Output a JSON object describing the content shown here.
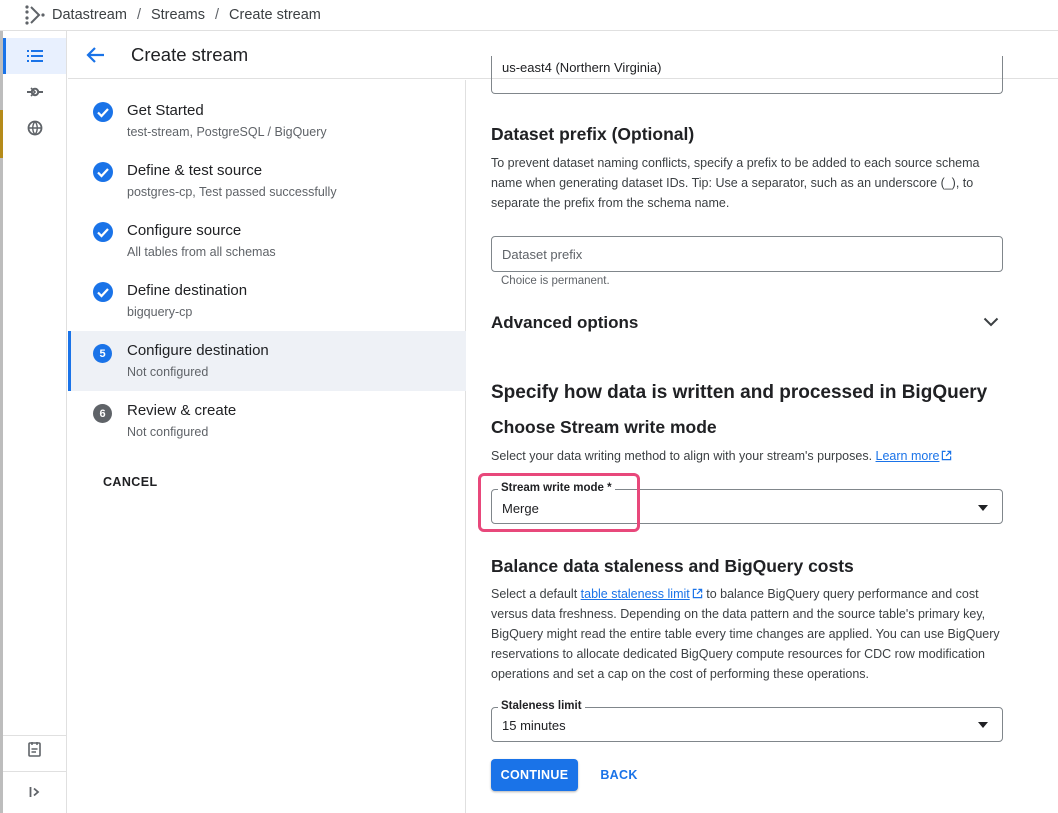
{
  "breadcrumb": {
    "items": [
      "Datastream",
      "Streams",
      "Create stream"
    ],
    "separator": "/"
  },
  "header": {
    "title": "Create stream"
  },
  "steps": [
    {
      "title": "Get Started",
      "subtitle": "test-stream, PostgreSQL / BigQuery",
      "status": "done"
    },
    {
      "title": "Define & test source",
      "subtitle": "postgres-cp, Test passed successfully",
      "status": "done"
    },
    {
      "title": "Configure source",
      "subtitle": "All tables from all schemas",
      "status": "done"
    },
    {
      "title": "Define destination",
      "subtitle": "bigquery-cp",
      "status": "done"
    },
    {
      "title": "Configure destination",
      "subtitle": "Not configured",
      "status": "current",
      "number": "5"
    },
    {
      "title": "Review & create",
      "subtitle": "Not configured",
      "status": "pending",
      "number": "6"
    }
  ],
  "cancel_label": "CANCEL",
  "region_field": {
    "value": "us-east4 (Northern Virginia)"
  },
  "dataset_prefix": {
    "heading": "Dataset prefix (Optional)",
    "description": "To prevent dataset naming conflicts, specify a prefix to be added to each source schema name when generating dataset IDs. Tip: Use a separator, such as an underscore (_), to separate the prefix from the schema name.",
    "placeholder": "Dataset prefix",
    "helper": "Choice is permanent."
  },
  "advanced_options": {
    "label": "Advanced options"
  },
  "write_section": {
    "heading": "Specify how data is written and processed in BigQuery",
    "subheading": "Choose Stream write mode",
    "description": "Select your data writing method to align with your stream's purposes.",
    "learn_more": "Learn more",
    "field_label": "Stream write mode *",
    "field_value": "Merge"
  },
  "staleness_section": {
    "heading": "Balance data staleness and BigQuery costs",
    "text_before_link": "Select a default",
    "link": "table staleness limit",
    "text_after_link": "to balance BigQuery query performance and cost versus data freshness. Depending on the data pattern and the source table's primary key, BigQuery might read the entire table every time changes are applied. You can use BigQuery reservations to allocate dedicated BigQuery compute resources for CDC row modification operations and set a cap on the cost of performing these operations.",
    "field_label": "Staleness limit",
    "field_value": "15 minutes"
  },
  "buttons": {
    "continue": "CONTINUE",
    "back": "BACK"
  },
  "colors": {
    "accent": "#1a73e8",
    "highlight": "#e8487b"
  }
}
